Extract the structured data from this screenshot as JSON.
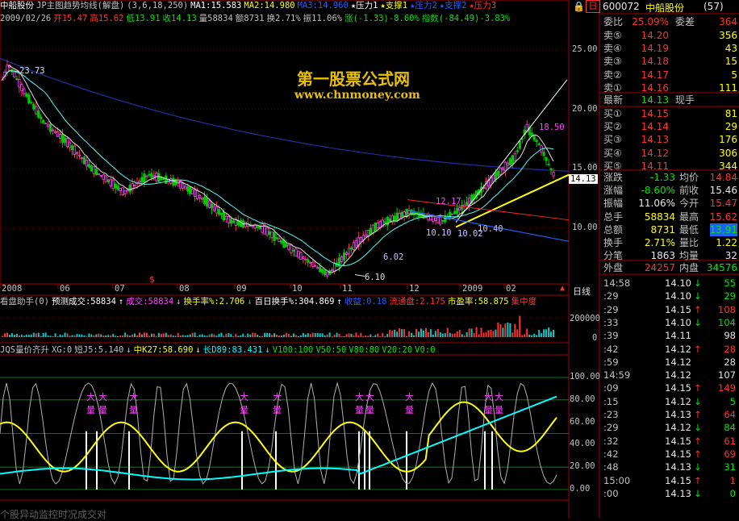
{
  "header": {
    "line1": [
      {
        "t": "中船股份",
        "c": "#ffffff"
      },
      {
        "t": "JP主图趋势均线(解盘)",
        "c": "#c0c0c0"
      },
      {
        "t": "(3,6,18,250)",
        "c": "#c0c0c0"
      },
      {
        "t": "MA1:15.583",
        "c": "#ffffff"
      },
      {
        "t": "MA2:14.980",
        "c": "#ffff00"
      },
      {
        "t": "MA3:14.960",
        "c": "#2060ff"
      },
      {
        "t": "★压力1",
        "c": "#ffffff"
      },
      {
        "t": "★支撑1",
        "c": "#ffff00"
      },
      {
        "t": "★压力2",
        "c": "#2060ff"
      },
      {
        "t": "★支撑2",
        "c": "#2060ff"
      },
      {
        "t": "★压力3",
        "c": "#ff3232"
      }
    ],
    "line2": [
      {
        "t": "2009/02/26",
        "c": "#c0c0c0"
      },
      {
        "t": "开15.47",
        "c": "#ff3232"
      },
      {
        "t": "高15.62",
        "c": "#ff3232"
      },
      {
        "t": "低13.91",
        "c": "#00e600"
      },
      {
        "t": "收14.13",
        "c": "#00e600"
      },
      {
        "t": "量58834",
        "c": "#c0c0c0"
      },
      {
        "t": "额8731",
        "c": "#c0c0c0"
      },
      {
        "t": "换2.71%",
        "c": "#c0c0c0"
      },
      {
        "t": "振11.06%",
        "c": "#c0c0c0"
      },
      {
        "t": "涨(-1.33)-8.60%",
        "c": "#00e600"
      },
      {
        "t": "指数(-84.49)-3.83%",
        "c": "#00e600"
      }
    ],
    "lock_icon": "lock-icon",
    "window_button": "日"
  },
  "watermark": {
    "title": "第一股票公式网",
    "url": "www.chnmoney.com"
  },
  "main_axis": {
    "ticks": [
      "25.00",
      "20.00",
      "15.00",
      "10.00"
    ],
    "current_price": "14.13"
  },
  "annotations": [
    "23.73",
    "6.10",
    "18.50",
    "12.17",
    "10.10",
    "10.02",
    "10.40",
    "6.02"
  ],
  "date_axis": {
    "labels": [
      "2008",
      "06",
      "07",
      "08",
      "09",
      "10",
      "11",
      "12",
      "2009",
      "02"
    ],
    "period": "日线"
  },
  "volume": {
    "title_items": [
      {
        "t": "看盘助手(0)",
        "c": "#c0c0c0"
      },
      {
        "t": "预测成交:58834",
        "c": "#ffffff"
      },
      {
        "t": "↑",
        "c": "#ffffff"
      },
      {
        "t": "成交:58834",
        "c": "#ff40ff"
      },
      {
        "t": "↓",
        "c": "#c0c0c0"
      },
      {
        "t": "换手率%:2.706",
        "c": "#ffff00"
      },
      {
        "t": "↓",
        "c": "#00e600"
      },
      {
        "t": "百日换手%:304.869",
        "c": "#ffffff"
      },
      {
        "t": "↑",
        "c": "#ffffff"
      },
      {
        "t": "收益:0.18",
        "c": "#2060ff"
      },
      {
        "t": "流通盘:2.175",
        "c": "#ff3232"
      },
      {
        "t": "市盈率:58.875",
        "c": "#ffff00"
      },
      {
        "t": "集中度",
        "c": "#ff3232"
      }
    ],
    "ticks": [
      "200000",
      "0"
    ]
  },
  "indicator": {
    "title_items": [
      {
        "t": "JQS量价齐升",
        "c": "#c0c0c0"
      },
      {
        "t": "XG:0",
        "c": "#c0c0c0"
      },
      {
        "t": "短J5:5.140",
        "c": "#c0c0c0"
      },
      {
        "t": "↓",
        "c": "#c0c0c0"
      },
      {
        "t": "中K27:58.690",
        "c": "#ffff00"
      },
      {
        "t": "↓",
        "c": "#ffff00"
      },
      {
        "t": "长D89:83.431",
        "c": "#00ffff"
      },
      {
        "t": "↓",
        "c": "#00ffff"
      },
      {
        "t": "V100:100",
        "c": "#00e600"
      },
      {
        "t": "V50:50",
        "c": "#00e600"
      },
      {
        "t": "V80:80",
        "c": "#00e600"
      },
      {
        "t": "V20:20",
        "c": "#00e600"
      },
      {
        "t": "V0:0",
        "c": "#00e600"
      }
    ],
    "ticks": [
      "100.00",
      "80.00",
      "60.00",
      "40.00",
      "20.00",
      "0.00"
    ],
    "marks": [
      "大量",
      "大量",
      "大量",
      "大量",
      "大量",
      "大量",
      "大量",
      "大量",
      "大量",
      "大量"
    ]
  },
  "chart_data": {
    "type": "candlestick",
    "symbol": "中船股份",
    "ylim": [
      5,
      27
    ],
    "x_labels": [
      "2008",
      "06",
      "07",
      "08",
      "09",
      "10",
      "11",
      "12",
      "2009",
      "02"
    ],
    "last_bar": {
      "date": "2009/02/26",
      "open": 15.47,
      "high": 15.62,
      "low": 13.91,
      "close": 14.13,
      "volume": 58834
    },
    "high_marker": 23.73,
    "low_marker": 6.1,
    "recent_high": 18.5,
    "ma": {
      "MA1": 15.583,
      "MA2": 14.98,
      "MA3": 14.96
    },
    "indicator_values": {
      "短J5": 5.14,
      "中K27": 58.69,
      "长D89": 83.431
    },
    "indicator_ylim": [
      0,
      100
    ]
  },
  "quote": {
    "code": "600072",
    "name": "中船股份",
    "num": "(57)",
    "weibi_l": "委比",
    "weibi": "25.09%",
    "weicha_l": "委差",
    "weicha": "364",
    "sells": [
      {
        "l": "卖⑤",
        "p": "14.20",
        "v": "356"
      },
      {
        "l": "卖④",
        "p": "14.19",
        "v": "43"
      },
      {
        "l": "卖③",
        "p": "14.18",
        "v": "15"
      },
      {
        "l": "卖②",
        "p": "14.17",
        "v": "5"
      },
      {
        "l": "卖①",
        "p": "14.16",
        "v": "111"
      }
    ],
    "latest_l": "最新",
    "latest": "14.13",
    "xianshou_l": "现手",
    "buys": [
      {
        "l": "买①",
        "p": "14.15",
        "v": "81"
      },
      {
        "l": "买②",
        "p": "14.14",
        "v": "29"
      },
      {
        "l": "买③",
        "p": "14.13",
        "v": "176"
      },
      {
        "l": "买④",
        "p": "14.12",
        "v": "306"
      },
      {
        "l": "买⑤",
        "p": "14.11",
        "v": "344"
      }
    ],
    "stats": [
      {
        "l1": "涨跌",
        "v1": "-1.33",
        "c1": "#00e600",
        "l2": "均价",
        "v2": "14.84",
        "c2": "#ff3232"
      },
      {
        "l1": "涨幅",
        "v1": "-8.60%",
        "c1": "#00e600",
        "l2": "前收",
        "v2": "15.46",
        "c2": "#e6e6e6"
      },
      {
        "l1": "振幅",
        "v1": "11.06%",
        "c1": "#e6e6e6",
        "l2": "今开",
        "v2": "15.47",
        "c2": "#ff3232"
      },
      {
        "l1": "总手",
        "v1": "58834",
        "c1": "#ffff00",
        "l2": "最高",
        "v2": "15.62",
        "c2": "#ff3232"
      },
      {
        "l1": "总额",
        "v1": "8731",
        "c1": "#ffff00",
        "l2": "最低",
        "v2": "13.91",
        "c2": "#00e600"
      },
      {
        "l1": "换手",
        "v1": "2.71%",
        "c1": "#ffff00",
        "l2": "量比",
        "v2": "1.22",
        "c2": "#ffff00"
      },
      {
        "l1": "分笔",
        "v1": "1863",
        "c1": "#e6e6e6",
        "l2": "均量",
        "v2": "32",
        "c2": "#e6e6e6"
      }
    ],
    "waipan_l": "外盘",
    "waipan": "24257",
    "neipan_l": "内盘",
    "neipan": "34576"
  },
  "ticks_list": [
    {
      "t": "14:58",
      "p": "14.10",
      "a": "↓",
      "ac": "#00e600",
      "q": "55"
    },
    {
      "t": ":29",
      "p": "14.10",
      "a": "↓",
      "ac": "#00e600",
      "q": "29"
    },
    {
      "t": ":29",
      "p": "14.15",
      "a": "↑",
      "ac": "#ff3232",
      "q": "108"
    },
    {
      "t": ":33",
      "p": "14.10",
      "a": "↓",
      "ac": "#00e600",
      "q": "104"
    },
    {
      "t": ":39",
      "p": "14.11",
      "a": "",
      "ac": "#c0c0c0",
      "q": "98"
    },
    {
      "t": ":42",
      "p": "14.12",
      "a": "↑",
      "ac": "#ff3232",
      "q": "28"
    },
    {
      "t": ":59",
      "p": "14.12",
      "a": "",
      "ac": "#c0c0c0",
      "q": "28"
    },
    {
      "t": "14:59",
      "p": "14.12",
      "a": "",
      "ac": "#c0c0c0",
      "q": "107"
    },
    {
      "t": ":09",
      "p": "14.15",
      "a": "↑",
      "ac": "#ff3232",
      "q": "149"
    },
    {
      "t": ":15",
      "p": "14.12",
      "a": "↓",
      "ac": "#00e600",
      "q": "5"
    },
    {
      "t": ":23",
      "p": "14.13",
      "a": "↑",
      "ac": "#ff3232",
      "q": "64"
    },
    {
      "t": ":29",
      "p": "14.12",
      "a": "↓",
      "ac": "#00e600",
      "q": "84"
    },
    {
      "t": ":32",
      "p": "14.15",
      "a": "↑",
      "ac": "#ff3232",
      "q": "61"
    },
    {
      "t": ":42",
      "p": "14.15",
      "a": "↑",
      "ac": "#ff3232",
      "q": "69"
    },
    {
      "t": ":48",
      "p": "14.13",
      "a": "↓",
      "ac": "#00e600",
      "q": "31"
    },
    {
      "t": "15:00",
      "p": "14.15",
      "a": "↑",
      "ac": "#ff3232",
      "q": "1"
    },
    {
      "t": ":00",
      "p": "14.13",
      "a": "↓",
      "ac": "#00e600",
      "q": "0"
    }
  ],
  "footer_text": "个股异动监控时况成交对"
}
